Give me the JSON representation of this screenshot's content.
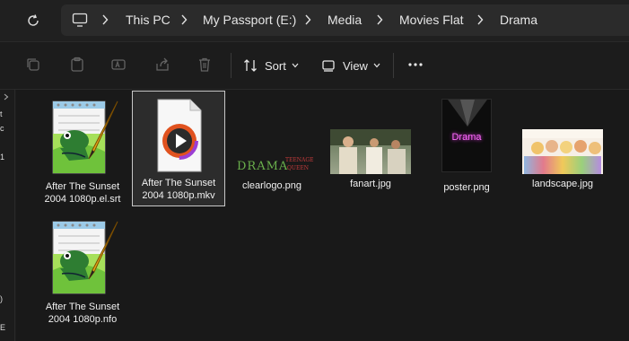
{
  "breadcrumb": [
    "This PC",
    "My Passport (E:)",
    "Media",
    "Movies Flat",
    "Drama"
  ],
  "toolbar": {
    "sort_label": "Sort",
    "view_label": "View"
  },
  "files": [
    {
      "name_line1": "After The Sunset",
      "name_line2": "2004 1080p.el.srt",
      "icon": "notepad-plus-plus-icon"
    },
    {
      "name_line1": "After The Sunset",
      "name_line2": "2004 1080p.mkv",
      "icon": "media-player-icon"
    },
    {
      "name": "clearlogo.png",
      "logo_text": "DRAMA",
      "logo_small": "TEENAGE",
      "logo_small2": "QUEEN"
    },
    {
      "name": "fanart.jpg"
    },
    {
      "name": "poster.png",
      "poster_text": "Drama"
    },
    {
      "name": "landscape.jpg"
    },
    {
      "name_line1": "After The Sunset",
      "name_line2": "2004 1080p.nfo",
      "icon": "notepad-plus-plus-icon"
    }
  ],
  "navpane_glimpses": [
    "t",
    "c",
    "1",
    ")",
    "E"
  ]
}
